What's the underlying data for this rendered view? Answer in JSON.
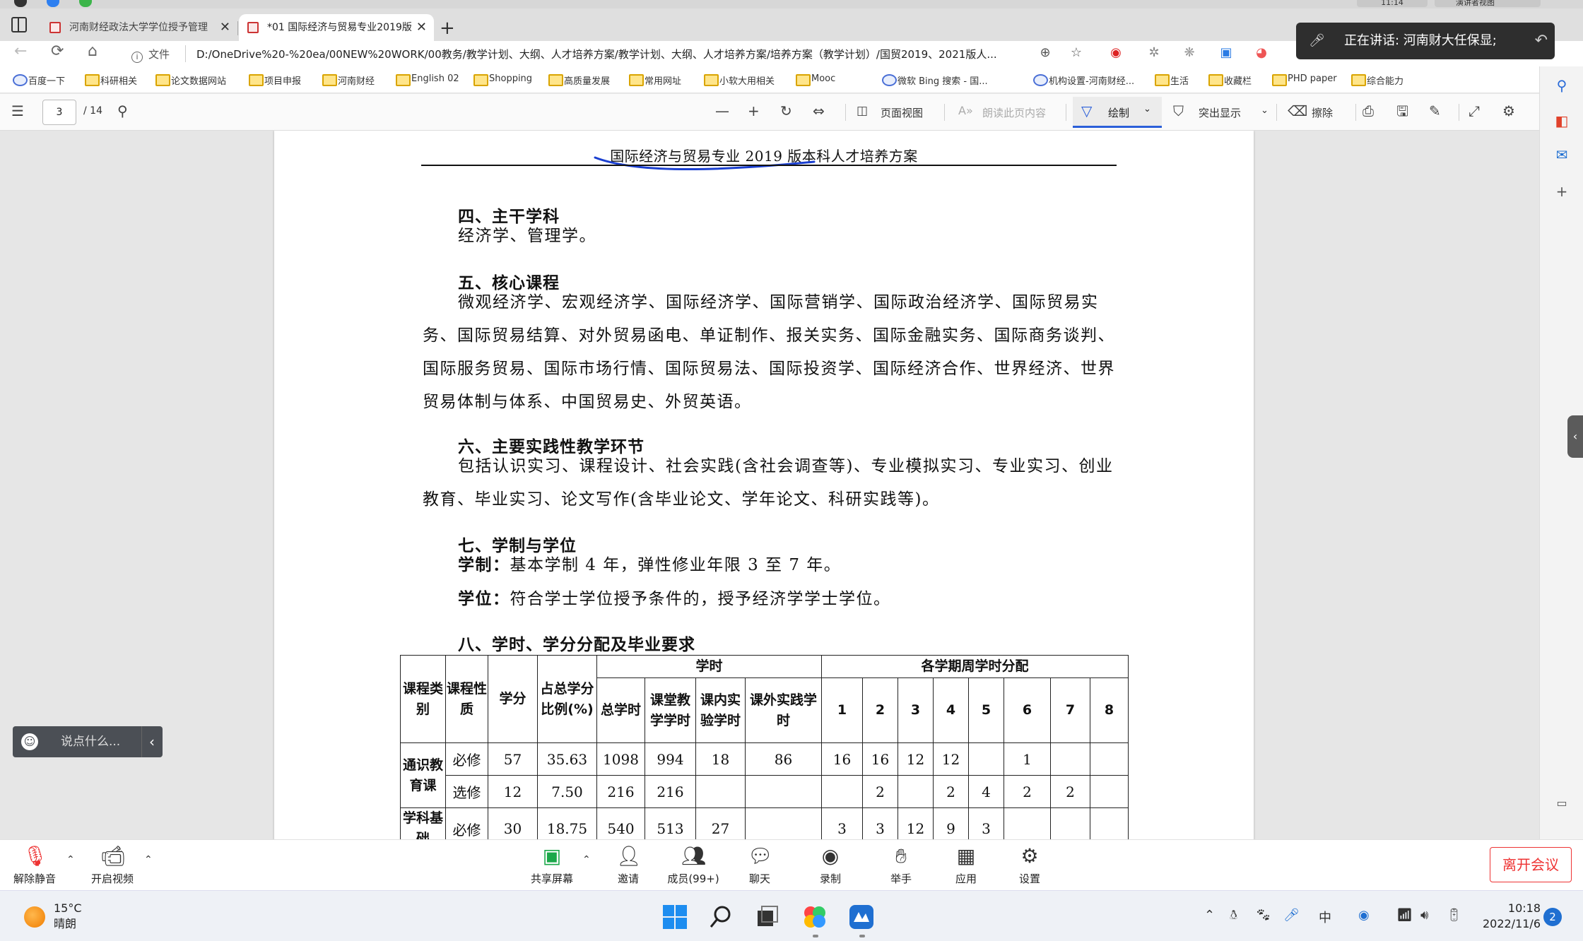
{
  "browser": {
    "tabs": [
      {
        "label": "河南财经政法大学学位授予管理"
      },
      {
        "label": "*01 国际经济与贸易专业2019版"
      }
    ],
    "address": {
      "scheme_label": "文件",
      "url": "D:/OneDrive%20-%20ea/00NEW%20WORK/00教务/教学计划、大纲、人才培养方案/教学计划、大纲、人才培养方案/培养方案（教学计划）/国贸2019、2021版人..."
    },
    "bookmarks": [
      "百度一下",
      "科研相关",
      "论文数据网站",
      "项目申报",
      "河南财经",
      "English 02",
      "Shopping",
      "高质量发展",
      "常用网址",
      "小软大用相关",
      "Mooc",
      "微软 Bing 搜索 - 国...",
      "机构设置-河南财经...",
      "生活",
      "收藏栏",
      "PHD paper",
      "综合能力"
    ]
  },
  "pdf_toolbar": {
    "page_current": "3",
    "page_total": "/ 14",
    "page_view_label": "页面视图",
    "read_aloud_label": "朗读此页内容",
    "draw_label": "绘制",
    "highlight_label": "突出显示",
    "erase_label": "擦除"
  },
  "document": {
    "header": "国际经济与贸易专业 2019 版本科人才培养方案",
    "s4_title": "四、主干学科",
    "s4_body": "经济学、管理学。",
    "s5_title": "五、核心课程",
    "s5_body": "微观经济学、宏观经济学、国际经济学、国际营销学、国际政治经济学、国际贸易实务、国际贸易结算、对外贸易函电、单证制作、报关实务、国际金融实务、国际商务谈判、国际服务贸易、国际市场行情、国际贸易法、国际投资学、国际经济合作、世界经济、世界贸易体制与体系、中国贸易史、外贸英语。",
    "s6_title": "六、主要实践性教学环节",
    "s6_body": "包括认识实习、课程设计、社会实践(含社会调查等)、专业模拟实习、专业实习、创业教育、毕业实习、论文写作(含毕业论文、学年论文、科研实践等)。",
    "s7_title": "七、学制与学位",
    "s7_l1_label": "学制：",
    "s7_l1_text": "基本学制 4 年，弹性修业年限 3 至 7 年。",
    "s7_l2_label": "学位：",
    "s7_l2_text": "符合学士学位授予条件的，授予经济学学士学位。",
    "s8_title": "八、学时、学分分配及毕业要求",
    "table": {
      "h_category": "课程类别",
      "h_nature": "课程性质",
      "h_credit": "学分",
      "h_ratio": "占总学分比例(%)",
      "h_hours": "学时",
      "h_total": "总学时",
      "h_class": "课堂教学学时",
      "h_lab": "课内实验学时",
      "h_extra": "课外实践学时",
      "h_weekly": "各学期周学时分配",
      "semesters": [
        "1",
        "2",
        "3",
        "4",
        "5",
        "6",
        "7",
        "8"
      ],
      "rows": [
        {
          "category": "通识教育课",
          "nature": "必修",
          "credit": "57",
          "ratio": "35.63",
          "total": "1098",
          "class": "994",
          "lab": "18",
          "extra": "86",
          "sem": [
            "16",
            "16",
            "12",
            "12",
            "",
            "1",
            "",
            ""
          ]
        },
        {
          "category": "",
          "nature": "选修",
          "credit": "12",
          "ratio": "7.50",
          "total": "216",
          "class": "216",
          "lab": "",
          "extra": "",
          "sem": [
            "",
            "2",
            "",
            "2",
            "4",
            "2",
            "2",
            ""
          ]
        },
        {
          "category": "学科基础",
          "nature": "必修",
          "credit": "30",
          "ratio": "18.75",
          "total": "540",
          "class": "513",
          "lab": "27",
          "extra": "",
          "sem": [
            "3",
            "3",
            "12",
            "9",
            "3",
            "",
            "",
            ""
          ]
        }
      ]
    }
  },
  "chat": {
    "placeholder": "说点什么..."
  },
  "speaking": {
    "text": "正在讲话: 河南财大任保显;"
  },
  "meeting": {
    "unmute": "解除静音",
    "video": "开启视频",
    "share": "共享屏幕",
    "invite": "邀请",
    "members": "成员(99+)",
    "chat": "聊天",
    "record": "录制",
    "raise_hand": "举手",
    "apps": "应用",
    "settings": "设置",
    "leave": "离开会议"
  },
  "taskbar": {
    "temperature": "15°C",
    "weather": "晴朗",
    "ime": "中",
    "time": "10:18",
    "date": "2022/11/6",
    "notifications": "2"
  },
  "top_strip": {
    "clock": "11:14",
    "view": "演讲者视图"
  },
  "colors": {
    "accent": "#2b5fd9",
    "leave_red": "#e33333",
    "ink": "#1a3fd0"
  }
}
